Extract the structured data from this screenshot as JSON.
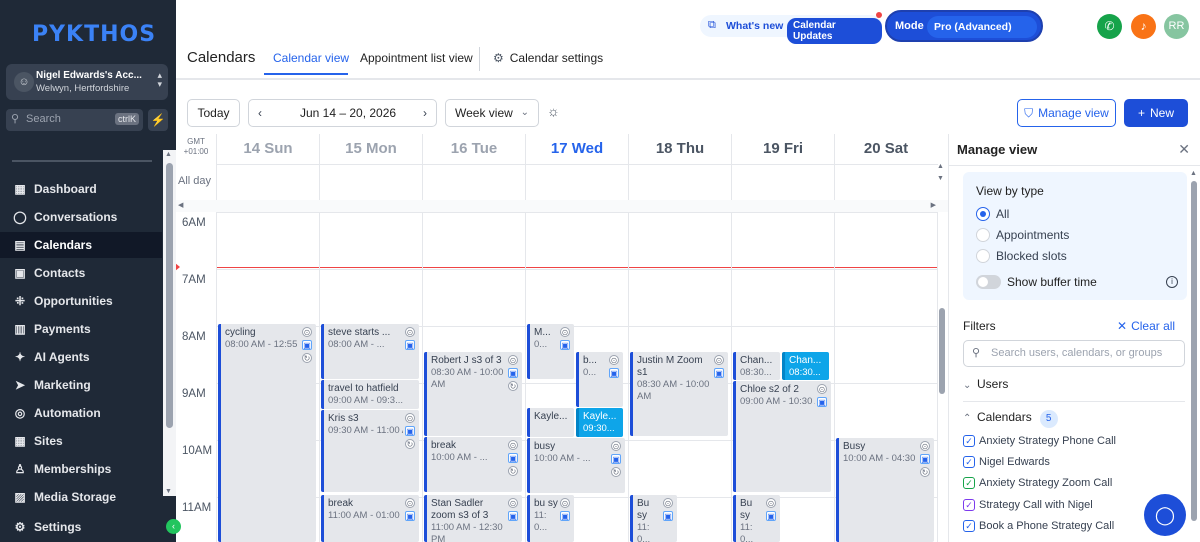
{
  "sidebar": {
    "logo": "PYKTHOS",
    "account": {
      "name": "Nigel Edwards's Acc...",
      "location": "Welwyn, Hertfordshire",
      "avatar": "☺"
    },
    "search": {
      "label": "Search",
      "shortcut": "ctrlK"
    },
    "items": [
      {
        "label": "Dashboard",
        "icon": "dashboard-icon",
        "glyph": "▦",
        "active": false
      },
      {
        "label": "Conversations",
        "icon": "chat-bubble-icon",
        "glyph": "◯",
        "active": false
      },
      {
        "label": "Calendars",
        "icon": "calendar-icon",
        "glyph": "▤",
        "active": true
      },
      {
        "label": "Contacts",
        "icon": "contacts-icon",
        "glyph": "▣",
        "active": false
      },
      {
        "label": "Opportunities",
        "icon": "opportunities-icon",
        "glyph": "⁜",
        "active": false
      },
      {
        "label": "Payments",
        "icon": "payments-icon",
        "glyph": "▥",
        "active": false
      },
      {
        "label": "AI Agents",
        "icon": "ai-agents-icon",
        "glyph": "✦",
        "active": false
      },
      {
        "label": "Marketing",
        "icon": "marketing-icon",
        "glyph": "➤",
        "active": false
      },
      {
        "label": "Automation",
        "icon": "automation-icon",
        "glyph": "◎",
        "active": false
      },
      {
        "label": "Sites",
        "icon": "sites-icon",
        "glyph": "▦",
        "active": false
      },
      {
        "label": "Memberships",
        "icon": "memberships-icon",
        "glyph": "♙",
        "active": false
      },
      {
        "label": "Media Storage",
        "icon": "media-storage-icon",
        "glyph": "▨",
        "active": false
      }
    ],
    "settings": "Settings"
  },
  "topbar": {
    "whats_new": "What's new",
    "calendar_updates": "Calendar Updates",
    "mode_label": "Mode",
    "mode_value": "Pro (Advanced)",
    "avatar_initials": "RR"
  },
  "header": {
    "title": "Calendars",
    "tabs": [
      "Calendar view",
      "Appointment list view"
    ],
    "settings": "Calendar settings"
  },
  "toolbar": {
    "today": "Today",
    "range": "Jun 14 – 20, 2026",
    "view": "Week view",
    "manage_view": "Manage view",
    "new": "New"
  },
  "calendar": {
    "timezone": "GMT +01:00",
    "all_day": "All day",
    "days": [
      {
        "label": "14 Sun",
        "state": "past"
      },
      {
        "label": "15 Mon",
        "state": "past"
      },
      {
        "label": "16 Tue",
        "state": "past"
      },
      {
        "label": "17 Wed",
        "state": "today"
      },
      {
        "label": "18 Thu",
        "state": "future"
      },
      {
        "label": "19 Fri",
        "state": "future"
      },
      {
        "label": "20 Sat",
        "state": "future"
      }
    ],
    "hours": [
      "6AM",
      "7AM",
      "8AM",
      "9AM",
      "10AM",
      "11AM"
    ],
    "events": [
      {
        "title": "cycling",
        "time": "08:00 AM - 12:55 PM"
      },
      {
        "title": "steve starts ...",
        "time": "08:00 AM - ..."
      },
      {
        "title": "travel to hatfield",
        "time": "09:00 AM - 09:3..."
      },
      {
        "title": "Kris s3",
        "time": "09:30 AM - 11:00 AM"
      },
      {
        "title": "break",
        "time": "11:00 AM - 01:00 PM"
      },
      {
        "title": "Robert J s3 of 3",
        "time": "08:30 AM - 10:00 AM"
      },
      {
        "title": "break",
        "time": "10:00 AM - ..."
      },
      {
        "title": "Stan Sadler zoom s3 of 3",
        "time": "11:00 AM - 12:30 PM"
      },
      {
        "title": "M...",
        "time": "0..."
      },
      {
        "title": "b...",
        "time": "0..."
      },
      {
        "title": "Kayle...",
        "time": ""
      },
      {
        "title": "Kayle...",
        "time": "09:30..."
      },
      {
        "title": "busy",
        "time": "10:00 AM - ..."
      },
      {
        "title": "bu sy",
        "time": "11: 0..."
      },
      {
        "title": "Justin M Zoom s1",
        "time": "08:30 AM - 10:00 AM"
      },
      {
        "title": "Bu sy",
        "time": "11: 0..."
      },
      {
        "title": "Chan...",
        "time": "08:30..."
      },
      {
        "title": "Chan...",
        "time": "08:30..."
      },
      {
        "title": "Chloe s2 of 2",
        "time": "09:00 AM - 10:30 AM"
      },
      {
        "title": "Bu sy",
        "time": "11: 0..."
      },
      {
        "title": "Busy",
        "time": "10:00 AM - 04:30 PM"
      }
    ]
  },
  "manage_view": {
    "title": "Manage view",
    "view_by_type": "View by type",
    "types": [
      "All",
      "Appointments",
      "Blocked slots"
    ],
    "selected_type": "All",
    "buffer": "Show buffer time",
    "filters": "Filters",
    "clear_all": "Clear all",
    "search_placeholder": "Search users, calendars, or groups",
    "users": "Users",
    "calendars_label": "Calendars",
    "calendars_count": "5",
    "calendar_items": [
      {
        "label": "Anxiety Strategy Phone Call",
        "color": "#2563eb"
      },
      {
        "label": "Nigel Edwards",
        "color": "#2563eb"
      },
      {
        "label": "Anxiety Strategy Zoom Call",
        "color": "#16a34a"
      },
      {
        "label": "Strategy Call with Nigel",
        "color": "#7c3aed"
      },
      {
        "label": "Book a Phone Strategy Call",
        "color": "#2563eb"
      }
    ]
  },
  "colors": {
    "accent": "#2563eb",
    "sidebar_bg": "#1f2937",
    "now_line": "#ef4444"
  }
}
